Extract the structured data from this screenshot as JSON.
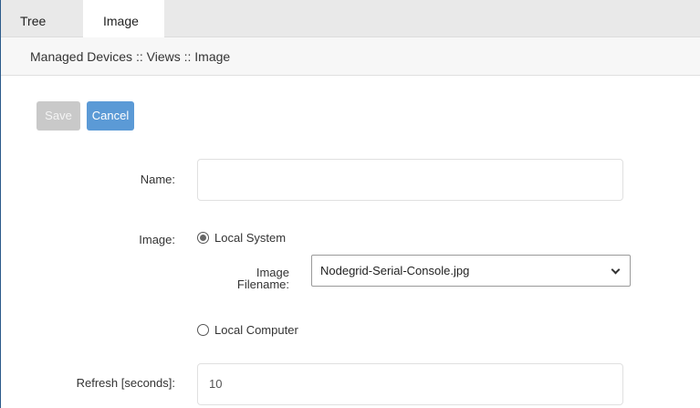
{
  "tabs": [
    {
      "label": "Tree",
      "active": false
    },
    {
      "label": "Image",
      "active": true
    }
  ],
  "breadcrumb": "Managed Devices :: Views :: Image",
  "toolbar": {
    "save_label": "Save",
    "cancel_label": "Cancel"
  },
  "form": {
    "name_label": "Name:",
    "name_value": "",
    "image_label": "Image:",
    "local_system_label": "Local System",
    "local_system_selected": true,
    "image_filename_label_line1": "Image",
    "image_filename_label_line2": "Filename:",
    "image_filename_value": "Nodegrid-Serial-Console.jpg",
    "local_computer_label": "Local Computer",
    "local_computer_selected": false,
    "refresh_label": "Refresh [seconds]:",
    "refresh_value": "10"
  },
  "colors": {
    "cancel_button": "#5b9ad6",
    "save_button_disabled": "#c9c9c9",
    "tabbar": "#e9e9e9",
    "frame_border": "#2b5a8a"
  }
}
